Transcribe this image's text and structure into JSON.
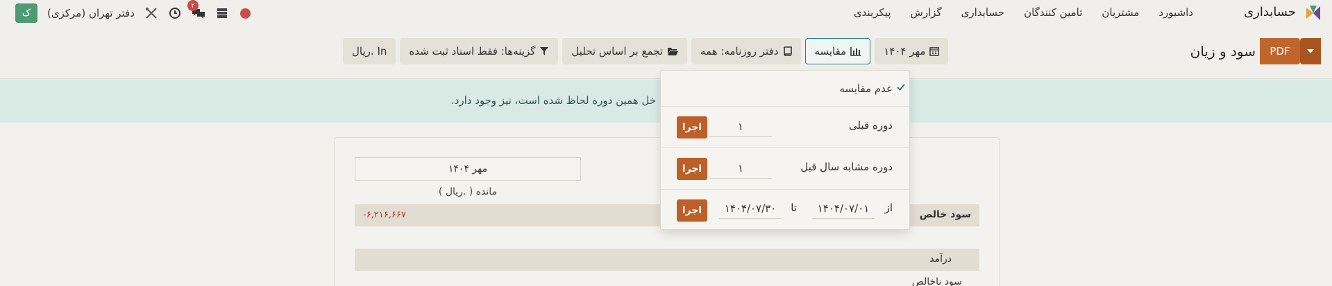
{
  "topnav": {
    "brand": "حسابداری",
    "menu": [
      {
        "label": "داشبورد"
      },
      {
        "label": "مشتریان"
      },
      {
        "label": "تامین کنندگان"
      },
      {
        "label": "حسابداری"
      },
      {
        "label": "گزارش"
      },
      {
        "label": "پیکربندی"
      }
    ],
    "company": "دفتر تهران (مرکزی)",
    "user_initial": "ک",
    "messages_count": "۲",
    "status_color": "#c74d4d"
  },
  "control_panel": {
    "title": "سود و زیان",
    "pdf_label": "PDF",
    "filters": {
      "date": "مهر ۱۴۰۴",
      "comparison": "مقایسه",
      "journals": "دفتر روزنامه: همه",
      "analytic": "تجمع بر اساس تحلیل",
      "options": "گزینه‌ها: فقط اسناد ثبت شده",
      "currency": "In .ریال"
    }
  },
  "alert": {
    "text": "خل همین دوره لحاظ شده است، نیز وجود دارد."
  },
  "report": {
    "period": "مهر ۱۴۰۴",
    "balance_label": "مانده ( .ریال )",
    "net_profit_label": "سود خالص",
    "net_profit_value": "-۶,۲۱۶,۶۶۷",
    "income_label": "درآمد",
    "gross_profit_label": "سود ناخالص"
  },
  "comparison_dropdown": {
    "no_comparison": "عدم مقایسه",
    "previous_period": "دوره قبلی",
    "previous_period_value": "۱",
    "same_period_last_year": "دوره مشابه سال قبل",
    "same_period_last_year_value": "۱",
    "from_label": "از",
    "from_value": "۱۴۰۴/۰۷/۰۱",
    "to_label": "تا",
    "to_value": "۱۴۰۴/۰۷/۳۰",
    "run_label": "اجرا"
  },
  "colors": {
    "accent": "#c0652b",
    "teal": "#2c7e76",
    "negative": "#c0392b"
  }
}
